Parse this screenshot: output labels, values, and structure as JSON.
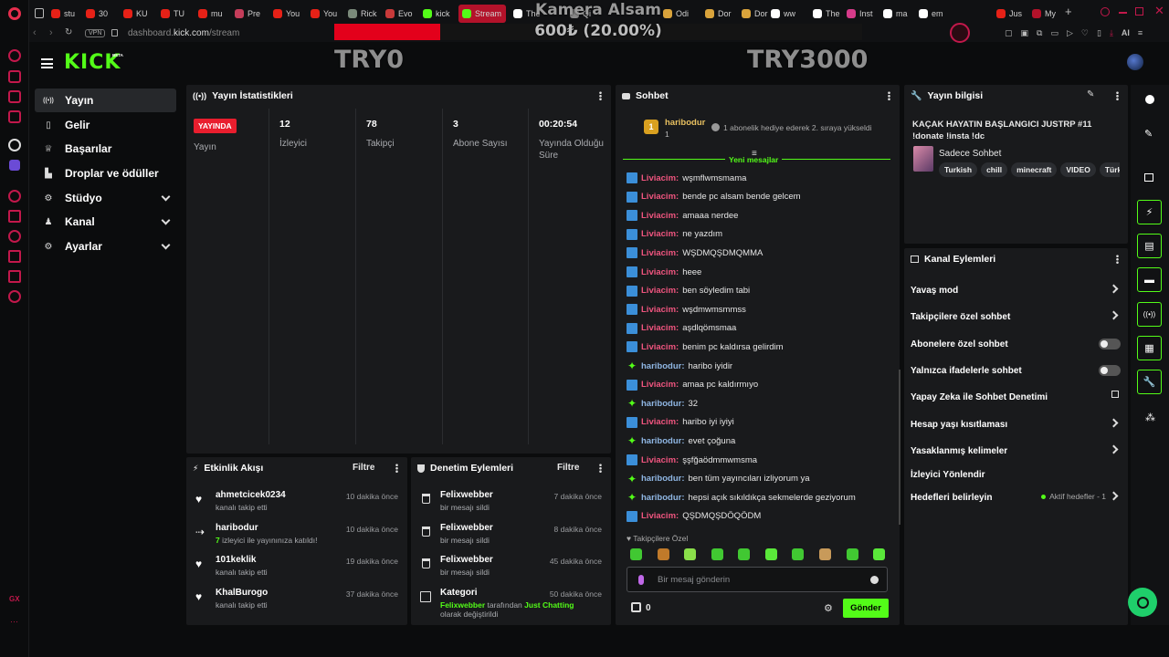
{
  "browser": {
    "tabs": [
      {
        "label": "stu",
        "color": "#e62117"
      },
      {
        "label": "30",
        "color": "#e62117"
      },
      {
        "label": "KU",
        "color": "#e62117"
      },
      {
        "label": "TU",
        "color": "#e62117"
      },
      {
        "label": "mu",
        "color": "#e62117"
      },
      {
        "label": "Pre",
        "color": "#c43d5a"
      },
      {
        "label": "You",
        "color": "#e62117"
      },
      {
        "label": "You",
        "color": "#e62117"
      },
      {
        "label": "Rick",
        "color": "#7a8a7a"
      },
      {
        "label": "Evo",
        "color": "#c83a3a"
      },
      {
        "label": "kick",
        "color": "#53fc18"
      },
      {
        "label": "Stream",
        "color": "#53fc18"
      },
      {
        "label": "The",
        "color": "#ffffff"
      },
      {
        "label": "Qi",
        "color": "#888888"
      },
      {
        "label": "Odi",
        "color": "#d9a33b"
      },
      {
        "label": "Dor",
        "color": "#d9a33b"
      },
      {
        "label": "Dor",
        "color": "#d9a33b"
      },
      {
        "label": "ww",
        "color": "#ffffff"
      },
      {
        "label": "The",
        "color": "#ffffff"
      },
      {
        "label": "Inst",
        "color": "#d63b8a"
      },
      {
        "label": "ma",
        "color": "#ffffff"
      },
      {
        "label": "em",
        "color": "#ffffff"
      },
      {
        "label": "Jus",
        "color": "#e62117"
      },
      {
        "label": "My",
        "color": "#b3122a"
      }
    ],
    "vpn": "VPN",
    "url_prefix": "dashboard.",
    "url_domain": "kick.com",
    "url_path": "/stream",
    "ai_label": "AI"
  },
  "overlay": {
    "title": "Kamera Alsam",
    "progress_text": "600₺ (20.00%)",
    "progress": 0.2,
    "left_amount": "TRY0",
    "right_amount": "TRY3000"
  },
  "header": {
    "logo": "KICK",
    "logo_tag": "BETA"
  },
  "sidebar": {
    "items": [
      {
        "label": "Yayın",
        "icon": "broadcast-icon"
      },
      {
        "label": "Gelir",
        "icon": "revenue-icon"
      },
      {
        "label": "Başarılar",
        "icon": "trophy-icon"
      },
      {
        "label": "Droplar ve ödüller",
        "icon": "drops-icon"
      },
      {
        "label": "Stüdyo",
        "icon": "studio-icon"
      },
      {
        "label": "Kanal",
        "icon": "channel-icon"
      },
      {
        "label": "Ayarlar",
        "icon": "settings-icon"
      }
    ]
  },
  "stats": {
    "title": "Yayın İstatistikleri",
    "live_badge": "YAYINDA",
    "live_label": "Yayın",
    "items": [
      {
        "value": "12",
        "label": "İzleyici"
      },
      {
        "value": "78",
        "label": "Takipçi"
      },
      {
        "value": "3",
        "label": "Abone Sayısı"
      },
      {
        "value": "00:20:54",
        "label": "Yayında Olduğu Süre"
      }
    ]
  },
  "chat": {
    "title": "Sohbet",
    "pinned_user": "haribodur",
    "pinned_count": "1",
    "pinned_text": "1 abonelik hediye ederek 2. sıraya yükseldi",
    "new_messages": "Yeni mesajlar",
    "messages": [
      {
        "user": "Liviacim",
        "text": "wşmflwmsmama",
        "kind": "pink"
      },
      {
        "user": "Liviacim",
        "text": "bende pc alsam bende gelcem",
        "kind": "pink"
      },
      {
        "user": "Liviacim",
        "text": "amaaa nerdee",
        "kind": "pink"
      },
      {
        "user": "Liviacim",
        "text": "ne yazdım",
        "kind": "pink"
      },
      {
        "user": "Liviacim",
        "text": "WŞDMQŞDMQMMA",
        "kind": "pink"
      },
      {
        "user": "Liviacim",
        "text": "heee",
        "kind": "pink"
      },
      {
        "user": "Liviacim",
        "text": "ben söyledim tabi",
        "kind": "pink"
      },
      {
        "user": "Liviacim",
        "text": "wşdmwmsmmss",
        "kind": "pink"
      },
      {
        "user": "Liviacim",
        "text": "aşdlqömsmaa",
        "kind": "pink"
      },
      {
        "user": "Liviacim",
        "text": "benim pc kaldırsa gelirdim",
        "kind": "pink"
      },
      {
        "user": "haribodur",
        "text": "haribo iyidir",
        "kind": "blue"
      },
      {
        "user": "Liviacim",
        "text": "amaa pc kaldırmıyo",
        "kind": "pink"
      },
      {
        "user": "haribodur",
        "text": "32",
        "kind": "blue"
      },
      {
        "user": "Liviacim",
        "text": "haribo iyi iyiyi",
        "kind": "pink"
      },
      {
        "user": "haribodur",
        "text": "evet çoğuna",
        "kind": "blue"
      },
      {
        "user": "Liviacim",
        "text": "şşfğaödmmwmsma",
        "kind": "pink"
      },
      {
        "user": "haribodur",
        "text": "ben tüm yayıncıları izliyorum ya",
        "kind": "blue"
      },
      {
        "user": "haribodur",
        "text": "hepsi açık sıkıldıkça sekmelerde geziyorum",
        "kind": "blue"
      },
      {
        "user": "Liviacim",
        "text": "QŞDMQŞDÖQÖDM",
        "kind": "pink"
      }
    ],
    "followers_only": "Takipçilere Özel",
    "input_placeholder": "Bir mesaj gönderin",
    "points": "0",
    "send_label": "Gönder"
  },
  "stream_info": {
    "title": "Yayın bilgisi",
    "stream_title": "KAÇAK HAYATIN BAŞLANGICI JUSTRP #11 !donate !insta !dc",
    "category": "Sadece Sohbet",
    "tags": [
      "Turkish",
      "chill",
      "minecraft",
      "VIDEO",
      "Türkçe"
    ]
  },
  "channel_actions": {
    "title": "Kanal Eylemleri",
    "items": [
      {
        "label": "Yavaş mod",
        "control": "arrow"
      },
      {
        "label": "Takipçilere özel sohbet",
        "control": "arrow"
      },
      {
        "label": "Abonelere özel sohbet",
        "control": "toggle"
      },
      {
        "label": "Yalnızca ifadelerle sohbet",
        "control": "toggle"
      },
      {
        "label": "Yapay Zeka ile Sohbet Denetimi",
        "control": "external"
      },
      {
        "label": "Hesap yaşı kısıtlaması",
        "control": "arrow"
      },
      {
        "label": "Yasaklanmış kelimeler",
        "control": "arrow"
      },
      {
        "label": "İzleyici Yönlendir",
        "control": "none"
      },
      {
        "label": "Hedefleri belirleyin",
        "control": "arrow"
      }
    ],
    "goals_status": "Aktif hedefler - 1"
  },
  "activity": {
    "title": "Etkinlik Akışı",
    "filter": "Filtre",
    "items": [
      {
        "name": "ahmetcicek0234",
        "sub": "kanalı takip etti",
        "time": "10 dakika önce",
        "icon": "heart-icon"
      },
      {
        "name": "haribodur",
        "sub_count": "7",
        "sub": " izleyici ile yayınınıza katıldı!",
        "time": "10 dakika önce",
        "icon": "raid-icon"
      },
      {
        "name": "101keklik",
        "sub": "kanalı takip etti",
        "time": "19 dakika önce",
        "icon": "heart-icon"
      },
      {
        "name": "KhalBurogo",
        "sub": "kanalı takip etti",
        "time": "37 dakika önce",
        "icon": "heart-icon"
      }
    ]
  },
  "moderation": {
    "title": "Denetim Eylemleri",
    "filter": "Filtre",
    "items": [
      {
        "name": "Felixwebber",
        "sub": "bir mesajı sildi",
        "time": "7 dakika önce"
      },
      {
        "name": "Felixwebber",
        "sub": "bir mesajı sildi",
        "time": "8 dakika önce"
      },
      {
        "name": "Felixwebber",
        "sub": "bir mesajı sildi",
        "time": "45 dakika önce"
      }
    ],
    "category_item": {
      "name": "Kategori",
      "actor": "Felixwebber",
      "mid": " tarafından ",
      "target": "Just Chatting",
      "end": " olarak değiştirildi",
      "time": "50 dakika önce"
    }
  },
  "opera_bottom": "GX",
  "colors": {
    "accent": "#53fc18",
    "live": "#e91e2e",
    "pink_user": "#f0557f",
    "blue_user": "#8fb6e3"
  }
}
